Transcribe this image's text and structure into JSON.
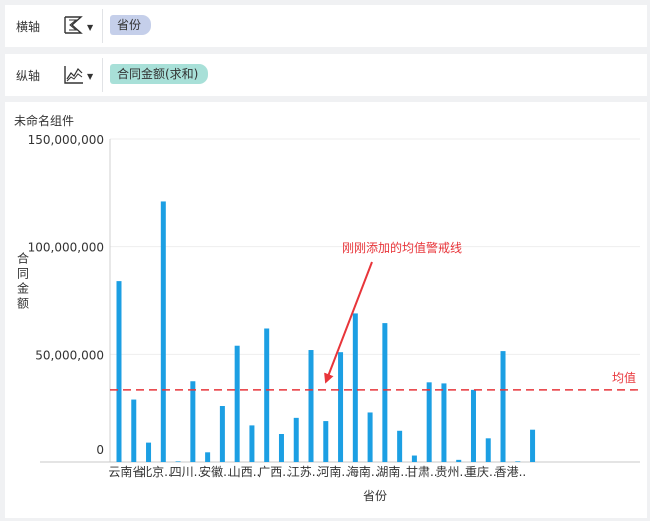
{
  "x_shelf": {
    "label": "横轴",
    "icon": "bar-chart-icon",
    "field": "省份"
  },
  "y_shelf": {
    "label": "纵轴",
    "icon": "line-chart-icon",
    "field": "合同金额(求和)"
  },
  "widget": {
    "title": "未命名组件"
  },
  "annotation": {
    "text": "刚刚添加的均值警戒线"
  },
  "colors": {
    "bar": "#1c9fe3",
    "avg_line": "#e8353a",
    "annotation": "#e8353a"
  },
  "chart_data": {
    "type": "bar",
    "xlabel": "省份",
    "ylabel": "合同金额",
    "ylim": [
      0,
      150000000
    ],
    "yticks": [
      0,
      50000000,
      100000000,
      150000000
    ],
    "ytick_labels": [
      "0",
      "50,000,000",
      "100,000,000",
      "150,000,000"
    ],
    "xtick_labels": [
      "云南省",
      "北京..",
      "四川..",
      "安徽..",
      "山西..",
      "广西..",
      "江苏..",
      "河南..",
      "海南..",
      "湖南..",
      "甘肃..",
      "贵州..",
      "重庆..",
      "香港.."
    ],
    "values": [
      84000000,
      29000000,
      9000000,
      121000000,
      300000,
      37500000,
      4500000,
      26000000,
      54000000,
      17000000,
      62000000,
      13000000,
      20500000,
      52000000,
      19000000,
      51000000,
      69000000,
      23000000,
      64500000,
      14500000,
      3000000,
      37000000,
      36500000,
      1000000,
      33500000,
      11000000,
      51500000,
      300000,
      15000000
    ],
    "average_line": {
      "value": 33500000,
      "label": "均值"
    }
  }
}
